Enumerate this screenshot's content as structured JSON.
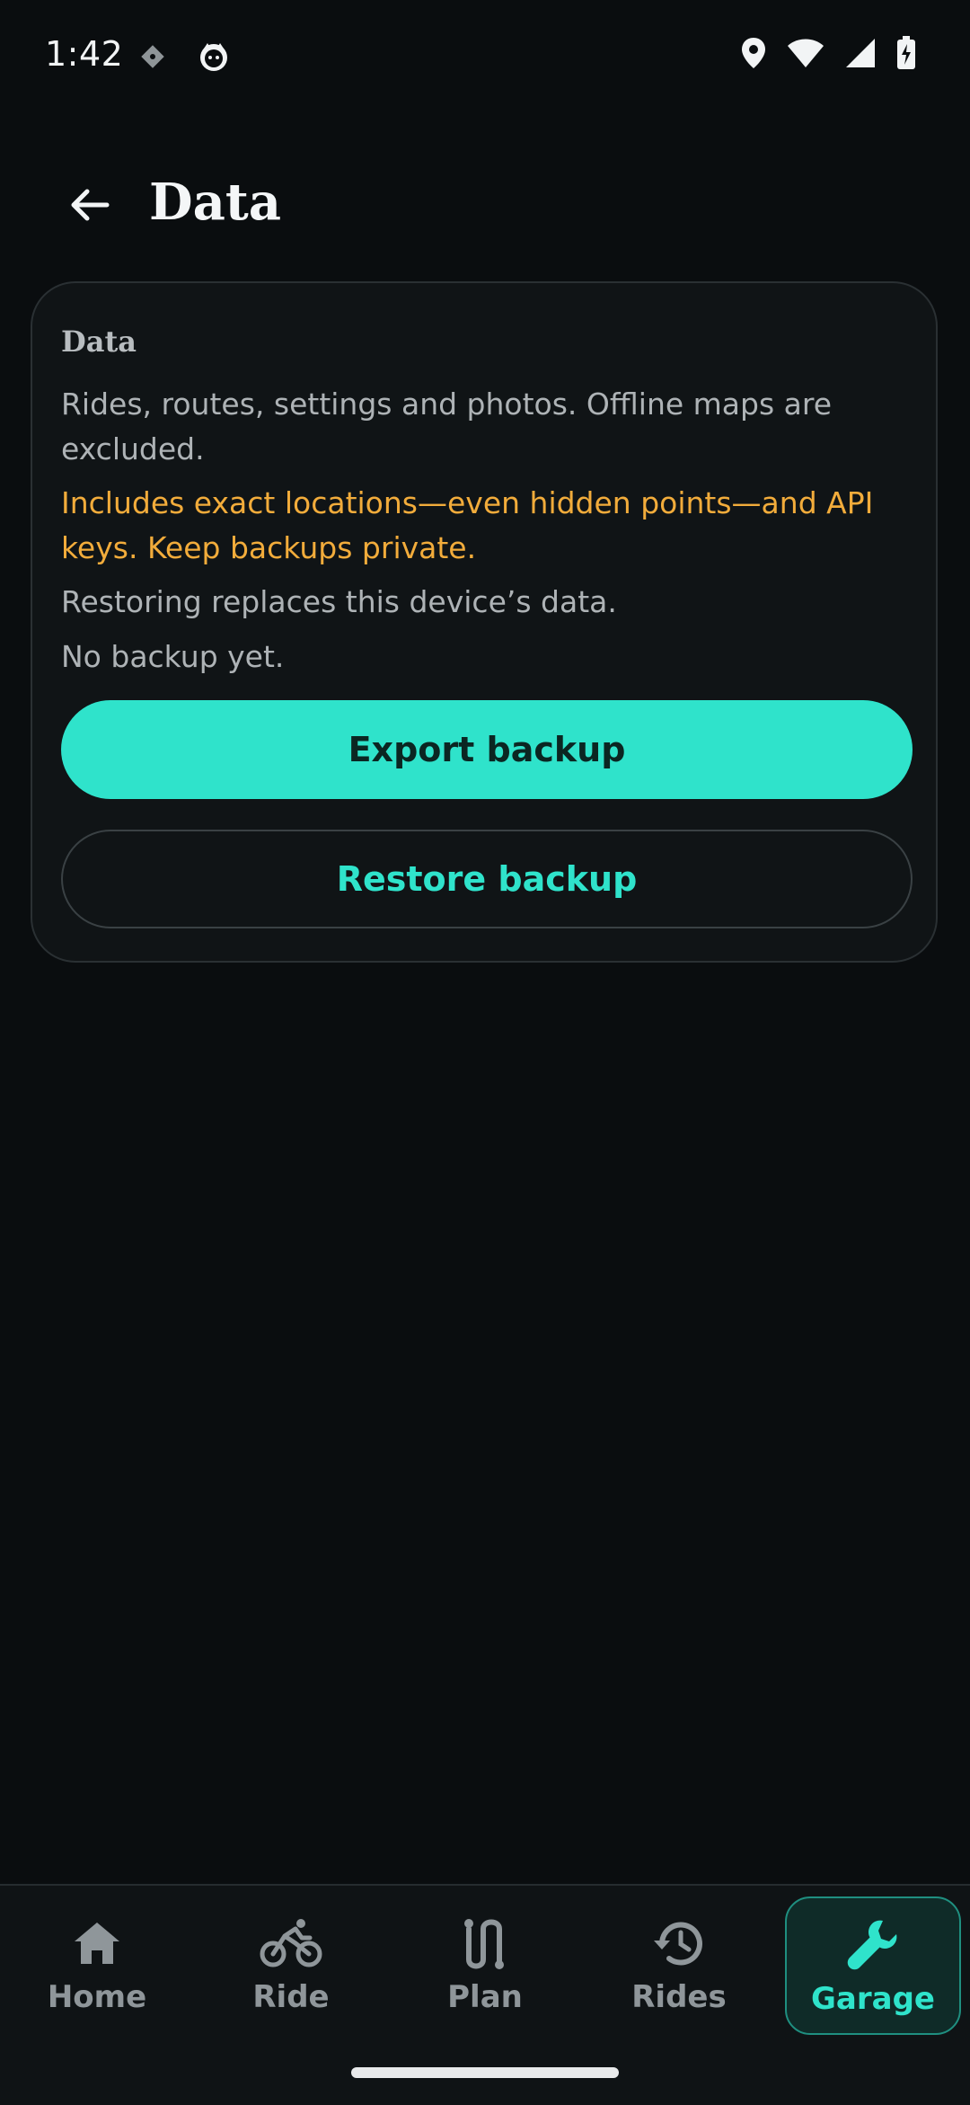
{
  "status_bar": {
    "time": "1:42",
    "left_icons": [
      "diamond-icon",
      "cat-icon"
    ],
    "right_icons": [
      "location-icon",
      "wifi-icon",
      "signal-icon",
      "battery-charging-icon"
    ]
  },
  "app_bar": {
    "back_icon": "arrow-left-icon",
    "title": "Data"
  },
  "card": {
    "heading": "Data",
    "description": "Rides, routes, settings and photos. Offline maps are excluded.",
    "warning": "Includes exact locations—even hidden points—and API keys. Keep backups private.",
    "restore_note": "Restoring replaces this device’s data.",
    "backup_status": "No backup yet.",
    "export_label": "Export backup",
    "restore_label": "Restore backup"
  },
  "bottom_nav": {
    "items": [
      {
        "label": "Home",
        "icon": "home-icon",
        "active": false
      },
      {
        "label": "Ride",
        "icon": "bicycle-icon",
        "active": false
      },
      {
        "label": "Plan",
        "icon": "route-icon",
        "active": false
      },
      {
        "label": "Rides",
        "icon": "history-icon",
        "active": false
      },
      {
        "label": "Garage",
        "icon": "wrench-icon",
        "active": true
      }
    ]
  },
  "colors": {
    "background": "#0a0d0f",
    "accent": "#2fe3cb",
    "warning": "#f2ac3b",
    "card": "#101416"
  }
}
